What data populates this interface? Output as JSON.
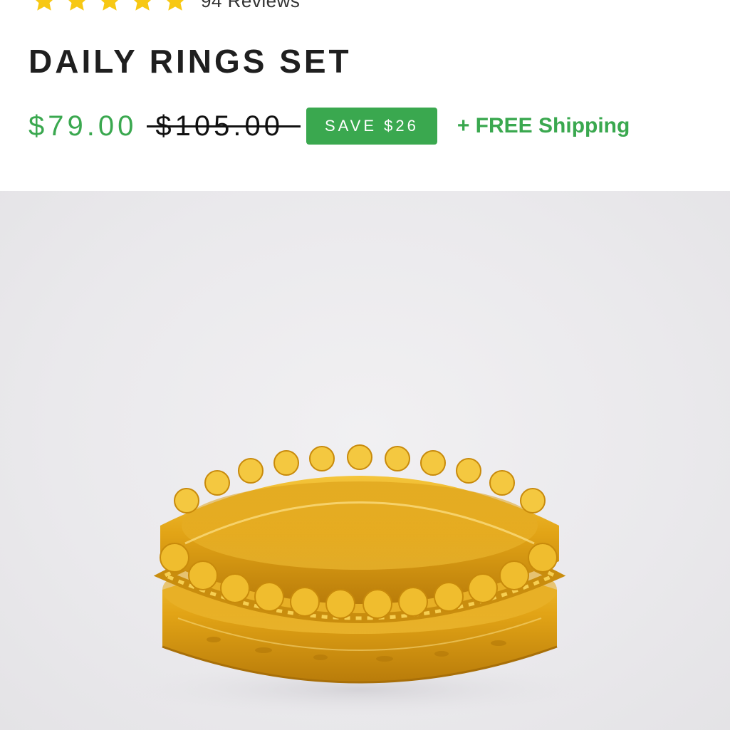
{
  "rating": {
    "stars": 5,
    "star_icon": "star-icon",
    "star_color": "#f7c814",
    "review_count": "94 Reviews"
  },
  "product": {
    "title": "DAILY RINGS SET",
    "price": "$79.00",
    "compare_price": "$105.00",
    "save_badge": "SAVE $26",
    "shipping_note": "+ FREE Shipping"
  },
  "colors": {
    "accent_green": "#3aa84f",
    "gold": "#e0a416"
  },
  "image": {
    "subject": "gold-stacked-rings-photo"
  }
}
